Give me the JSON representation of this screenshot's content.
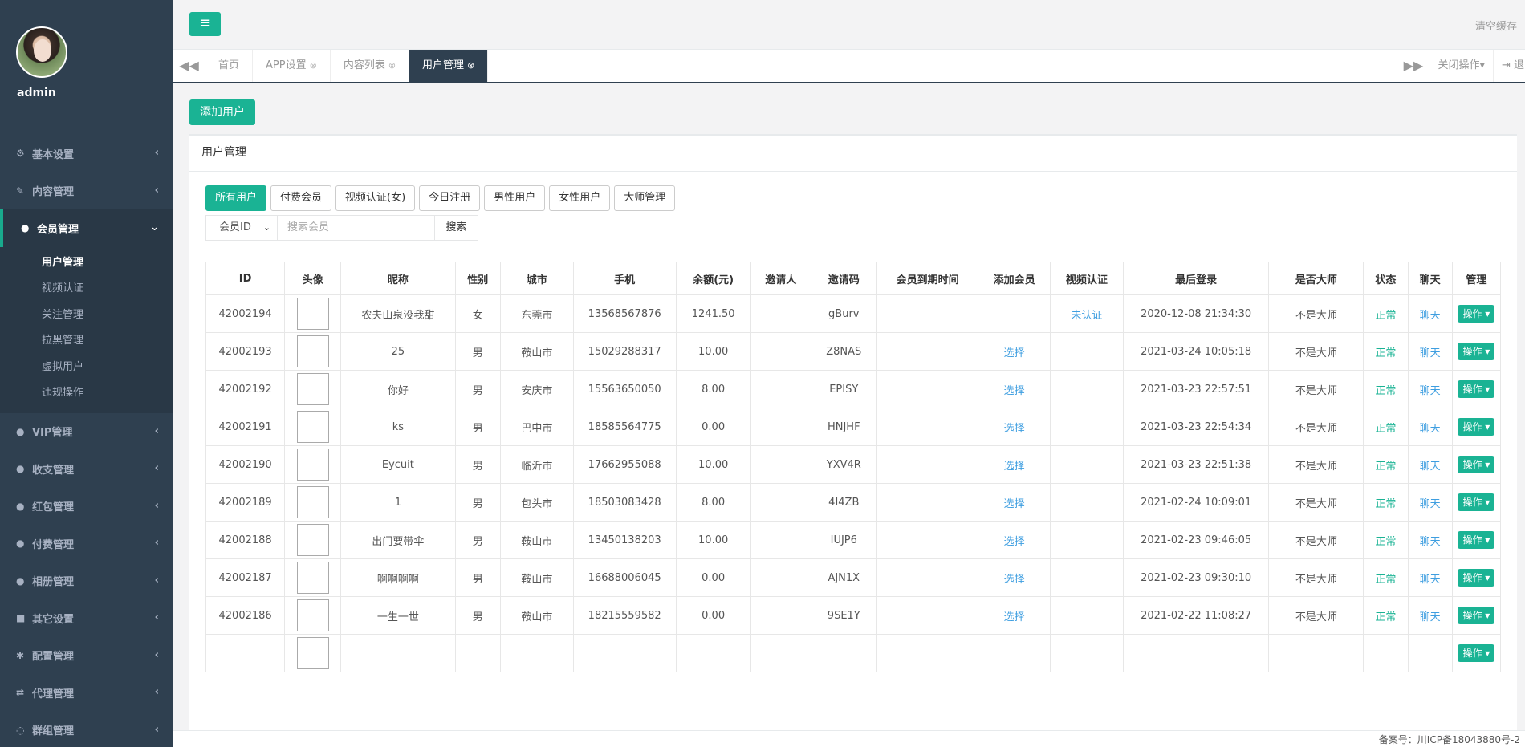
{
  "profile": {
    "username": "admin"
  },
  "sidebar": {
    "items": [
      {
        "label": "基本设置",
        "icon": "gear-icon"
      },
      {
        "label": "内容管理",
        "icon": "edit-icon"
      },
      {
        "label": "会员管理",
        "icon": "user-icon"
      },
      {
        "label": "VIP管理",
        "icon": "user-icon"
      },
      {
        "label": "收支管理",
        "icon": "user-icon"
      },
      {
        "label": "红包管理",
        "icon": "user-icon"
      },
      {
        "label": "付费管理",
        "icon": "user-icon"
      },
      {
        "label": "相册管理",
        "icon": "user-icon"
      },
      {
        "label": "其它设置",
        "icon": "book-icon"
      },
      {
        "label": "配置管理",
        "icon": "asterisk-icon"
      },
      {
        "label": "代理管理",
        "icon": "exchange-icon"
      },
      {
        "label": "群组管理",
        "icon": "comment-icon"
      }
    ],
    "submenu": [
      "用户管理",
      "视频认证",
      "关注管理",
      "拉黑管理",
      "虚拟用户",
      "违规操作"
    ]
  },
  "topbar": {
    "clear_cache": "清空缓存"
  },
  "tabs": [
    {
      "label": "首页"
    },
    {
      "label": "APP设置"
    },
    {
      "label": "内容列表"
    },
    {
      "label": "用户管理"
    }
  ],
  "tabbar": {
    "close_ops": "关闭操作",
    "logout": "退出"
  },
  "toolbar": {
    "add_user": "添加用户"
  },
  "panel": {
    "title": "用户管理"
  },
  "filters": [
    "所有用户",
    "付费会员",
    "视频认证(女)",
    "今日注册",
    "男性用户",
    "女性用户",
    "大师管理"
  ],
  "search": {
    "field": "会员ID",
    "placeholder": "搜索会员",
    "button": "搜索"
  },
  "table": {
    "columns": [
      "ID",
      "头像",
      "昵称",
      "性别",
      "城市",
      "手机",
      "余额(元)",
      "邀请人",
      "邀请码",
      "会员到期时间",
      "添加会员",
      "视频认证",
      "最后登录",
      "是否大师",
      "状态",
      "聊天",
      "管理"
    ],
    "rows": [
      {
        "id": "42002194",
        "nick": "农夫山泉没我甜",
        "gender": "女",
        "city": "东莞市",
        "phone": "13568567876",
        "balance": "1241.50",
        "inviter": "",
        "code": "gBurv",
        "expire": "",
        "add": "",
        "video": "未认证",
        "last": "2020-12-08 21:34:30",
        "master": "不是大师",
        "status": "正常",
        "chat": "聊天",
        "op": "操作"
      },
      {
        "id": "42002193",
        "nick": "25",
        "gender": "男",
        "city": "鞍山市",
        "phone": "15029288317",
        "balance": "10.00",
        "inviter": "",
        "code": "Z8NAS",
        "expire": "",
        "add": "选择",
        "video": "",
        "last": "2021-03-24 10:05:18",
        "master": "不是大师",
        "status": "正常",
        "chat": "聊天",
        "op": "操作"
      },
      {
        "id": "42002192",
        "nick": "你好",
        "gender": "男",
        "city": "安庆市",
        "phone": "15563650050",
        "balance": "8.00",
        "inviter": "",
        "code": "EPISY",
        "expire": "",
        "add": "选择",
        "video": "",
        "last": "2021-03-23 22:57:51",
        "master": "不是大师",
        "status": "正常",
        "chat": "聊天",
        "op": "操作"
      },
      {
        "id": "42002191",
        "nick": "ks",
        "gender": "男",
        "city": "巴中市",
        "phone": "18585564775",
        "balance": "0.00",
        "inviter": "",
        "code": "HNJHF",
        "expire": "",
        "add": "选择",
        "video": "",
        "last": "2021-03-23 22:54:34",
        "master": "不是大师",
        "status": "正常",
        "chat": "聊天",
        "op": "操作"
      },
      {
        "id": "42002190",
        "nick": "Eycuit",
        "gender": "男",
        "city": "临沂市",
        "phone": "17662955088",
        "balance": "10.00",
        "inviter": "",
        "code": "YXV4R",
        "expire": "",
        "add": "选择",
        "video": "",
        "last": "2021-03-23 22:51:38",
        "master": "不是大师",
        "status": "正常",
        "chat": "聊天",
        "op": "操作"
      },
      {
        "id": "42002189",
        "nick": "1",
        "gender": "男",
        "city": "包头市",
        "phone": "18503083428",
        "balance": "8.00",
        "inviter": "",
        "code": "4I4ZB",
        "expire": "",
        "add": "选择",
        "video": "",
        "last": "2021-02-24 10:09:01",
        "master": "不是大师",
        "status": "正常",
        "chat": "聊天",
        "op": "操作"
      },
      {
        "id": "42002188",
        "nick": "出门要带伞",
        "gender": "男",
        "city": "鞍山市",
        "phone": "13450138203",
        "balance": "10.00",
        "inviter": "",
        "code": "IUJP6",
        "expire": "",
        "add": "选择",
        "video": "",
        "last": "2021-02-23 09:46:05",
        "master": "不是大师",
        "status": "正常",
        "chat": "聊天",
        "op": "操作"
      },
      {
        "id": "42002187",
        "nick": "啊啊啊啊",
        "gender": "男",
        "city": "鞍山市",
        "phone": "16688006045",
        "balance": "0.00",
        "inviter": "",
        "code": "AJN1X",
        "expire": "",
        "add": "选择",
        "video": "",
        "last": "2021-02-23 09:30:10",
        "master": "不是大师",
        "status": "正常",
        "chat": "聊天",
        "op": "操作"
      },
      {
        "id": "42002186",
        "nick": "一生一世",
        "gender": "男",
        "city": "鞍山市",
        "phone": "18215559582",
        "balance": "0.00",
        "inviter": "",
        "code": "9SE1Y",
        "expire": "",
        "add": "选择",
        "video": "",
        "last": "2021-02-22 11:08:27",
        "master": "不是大师",
        "status": "正常",
        "chat": "聊天",
        "op": "操作"
      },
      {
        "id": "",
        "nick": "",
        "gender": "",
        "city": "",
        "phone": "",
        "balance": "",
        "inviter": "",
        "code": "",
        "expire": "",
        "add": "",
        "video": "",
        "last": "",
        "master": "",
        "status": "",
        "chat": "",
        "op": "操作"
      }
    ]
  },
  "footer": {
    "icp": "备案号：川ICP备18043880号-2"
  }
}
